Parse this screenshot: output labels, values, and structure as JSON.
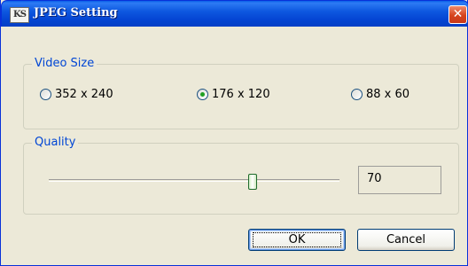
{
  "window": {
    "title": "JPEG Setting",
    "icon_text": "KS"
  },
  "close_glyph": "✕",
  "video_size": {
    "label": "Video Size",
    "options": [
      {
        "label": "352 x 240",
        "selected": false
      },
      {
        "label": "176 x 120",
        "selected": true
      },
      {
        "label": "88 x 60",
        "selected": false
      }
    ]
  },
  "quality": {
    "label": "Quality",
    "value": "70",
    "slider_fraction": 0.7
  },
  "buttons": {
    "ok": "OK",
    "cancel": "Cancel"
  },
  "colors": {
    "titlebar": "#0546D4",
    "group_label": "#0046D5",
    "close": "#D6431D",
    "radio_dot": "#21A121"
  }
}
